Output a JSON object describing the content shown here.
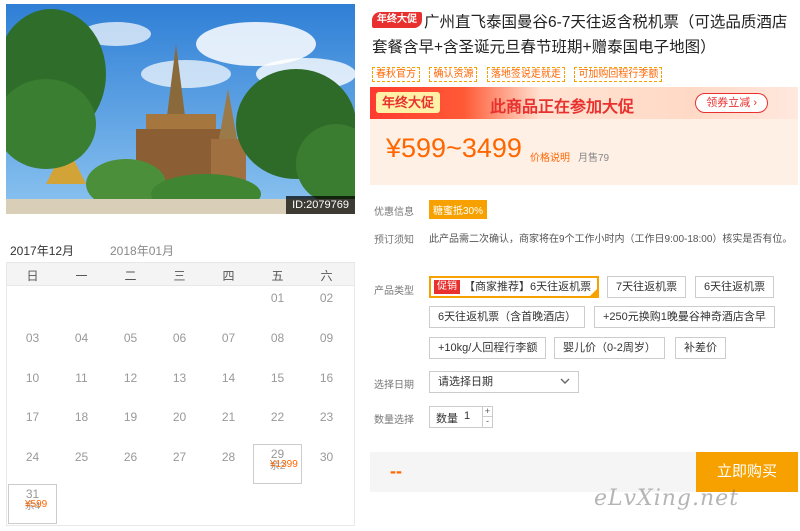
{
  "photo": {
    "id_label": "ID:2079769"
  },
  "calendar": {
    "months": [
      "2017年12月",
      "2018年01月"
    ],
    "weekdays": [
      "日",
      "一",
      "二",
      "三",
      "四",
      "五",
      "六"
    ],
    "days": [
      {
        "n": "01",
        "col": 5,
        "row": 0
      },
      {
        "n": "02",
        "col": 6,
        "row": 0
      },
      {
        "n": "03",
        "col": 0,
        "row": 1
      },
      {
        "n": "04",
        "col": 1,
        "row": 1
      },
      {
        "n": "05",
        "col": 2,
        "row": 1
      },
      {
        "n": "06",
        "col": 3,
        "row": 1
      },
      {
        "n": "07",
        "col": 4,
        "row": 1
      },
      {
        "n": "08",
        "col": 5,
        "row": 1
      },
      {
        "n": "09",
        "col": 6,
        "row": 1
      },
      {
        "n": "10",
        "col": 0,
        "row": 2
      },
      {
        "n": "11",
        "col": 1,
        "row": 2
      },
      {
        "n": "12",
        "col": 2,
        "row": 2
      },
      {
        "n": "13",
        "col": 3,
        "row": 2
      },
      {
        "n": "14",
        "col": 4,
        "row": 2
      },
      {
        "n": "15",
        "col": 5,
        "row": 2
      },
      {
        "n": "16",
        "col": 6,
        "row": 2
      },
      {
        "n": "17",
        "col": 0,
        "row": 3
      },
      {
        "n": "18",
        "col": 1,
        "row": 3
      },
      {
        "n": "19",
        "col": 2,
        "row": 3
      },
      {
        "n": "20",
        "col": 3,
        "row": 3
      },
      {
        "n": "21",
        "col": 4,
        "row": 3
      },
      {
        "n": "22",
        "col": 5,
        "row": 3
      },
      {
        "n": "23",
        "col": 6,
        "row": 3
      },
      {
        "n": "24",
        "col": 0,
        "row": 4
      },
      {
        "n": "25",
        "col": 1,
        "row": 4
      },
      {
        "n": "26",
        "col": 2,
        "row": 4
      },
      {
        "n": "27",
        "col": 3,
        "row": 4
      },
      {
        "n": "28",
        "col": 4,
        "row": 4
      },
      {
        "n": "29",
        "col": 5,
        "row": 4,
        "price": "¥1399",
        "left": "余2"
      },
      {
        "n": "30",
        "col": 6,
        "row": 4
      },
      {
        "n": "31",
        "col": 0,
        "row": 5,
        "price": "¥599",
        "left": "余4"
      }
    ]
  },
  "product": {
    "badge": "年终大促",
    "title": "广州直飞泰国曼谷6-7天往返含税机票（可选品质酒店套餐含早+含圣诞元旦春节班期+赠泰国电子地图）",
    "tags": [
      "春秋官方",
      "确认资源",
      "落地签说走就走",
      "可加购回程行李额"
    ]
  },
  "banner": {
    "chip": "年终大促",
    "text": "此商品正在参加大促",
    "coupon": "领券立减 ›"
  },
  "pricing": {
    "price": "¥599~3499",
    "note": "价格说明",
    "sold": "月售79"
  },
  "info": {
    "discount_label": "优惠信息",
    "discount": "糖蜜抵30%",
    "notice_label": "预订须知",
    "notice": "此产品需二次确认，商家将在9个工作小时内（工作日9:00-18:00）核实是否有位。"
  },
  "options": {
    "label": "产品类型",
    "promo": "促销",
    "items": [
      "【商家推荐】6天往返机票",
      "7天往返机票",
      "6天往返机票",
      "6天往返机票（含首晚酒店）",
      "+250元换购1晚曼谷神奇酒店含早",
      "+10kg/人回程行李额",
      "婴儿价（0-2周岁）",
      "补差价"
    ]
  },
  "date": {
    "label": "选择日期",
    "placeholder": "请选择日期"
  },
  "quantity": {
    "label": "数量选择",
    "field_label": "数量",
    "value": "1",
    "up": "+",
    "down": "-"
  },
  "buy": {
    "total": "--",
    "button": "立即购买"
  },
  "watermark": "eLvXing.net"
}
